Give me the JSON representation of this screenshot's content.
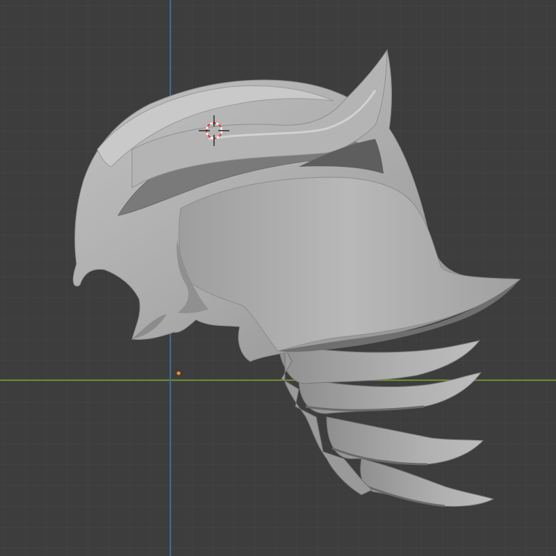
{
  "viewport": {
    "background": "#3d3d3d",
    "grid_minor_color": "#454545",
    "grid_major_color": "#4f4f4f",
    "x_axis_color": "#7a9a3a",
    "y_axis_color": "#3f6f9f",
    "origin_marker_color": "#ff8a1f",
    "cursor_colors": [
      "#e23b3b",
      "#ffffff"
    ],
    "mesh_color": "#a7a7a7",
    "mesh_shadow": "#6f6f6f",
    "mesh_highlight": "#cfcfcf"
  },
  "objects": [
    {
      "name": "helmet-mesh",
      "kind": "sculpt-mesh"
    }
  ],
  "icons": {
    "cursor": "3d-cursor-icon",
    "origin": "origin-dot-icon"
  }
}
